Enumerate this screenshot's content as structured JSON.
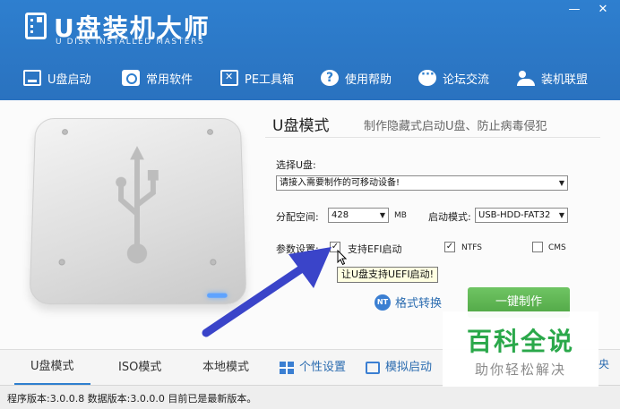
{
  "app": {
    "title": "U盘装机大师",
    "subtitle": "U DISK INSTALLED MASTERS",
    "minimize": "—",
    "close": "✕"
  },
  "nav": [
    {
      "label": "U盘启动",
      "icon": "usb-drive-icon"
    },
    {
      "label": "常用软件",
      "icon": "software-icon"
    },
    {
      "label": "PE工具箱",
      "icon": "toolbox-icon"
    },
    {
      "label": "使用帮助",
      "icon": "help-icon"
    },
    {
      "label": "论坛交流",
      "icon": "forum-icon"
    },
    {
      "label": "装机联盟",
      "icon": "users-icon"
    }
  ],
  "mode": {
    "title": "U盘模式",
    "description": "制作隐藏式启动U盘、防止病毒侵犯"
  },
  "form": {
    "select_usb_label": "选择U盘:",
    "usb_value": "请接入需要制作的可移动设备!",
    "alloc_label": "分配空间:",
    "alloc_value": "428",
    "alloc_unit": "MB",
    "boot_mode_label": "启动模式:",
    "boot_mode_value": "USB-HDD-FAT32",
    "params_label": "参数设置:",
    "efi_label": "支持EFI启动",
    "efi_checked": true,
    "ntfs_label": "NTFS",
    "ntfs_checked": true,
    "cms_label": "CMS",
    "cms_checked": false,
    "tooltip": "让U盘支持UEFI启动!"
  },
  "actions": {
    "convert_icon_text": "NT",
    "convert_label": "格式转换",
    "make_label": "一键制作"
  },
  "tabs": [
    {
      "label": "U盘模式",
      "active": true
    },
    {
      "label": "ISO模式",
      "active": false
    },
    {
      "label": "本地模式",
      "active": false
    },
    {
      "label": "个性设置",
      "active": false,
      "icon": "grid-icon"
    },
    {
      "label": "模拟启动",
      "active": false,
      "icon": "screen-icon"
    }
  ],
  "status": {
    "text": "程序版本:3.0.0.8  数据版本:3.0.0.0 目前已是最新版本。"
  },
  "watermark": {
    "title": "百科全说",
    "subtitle": "助你轻松解决",
    "edge": "央"
  },
  "colors": {
    "header": "#2e7fcf",
    "accent": "#3b7fd2",
    "make_button": "#5bb44f",
    "watermark_green": "#2aa84a"
  }
}
